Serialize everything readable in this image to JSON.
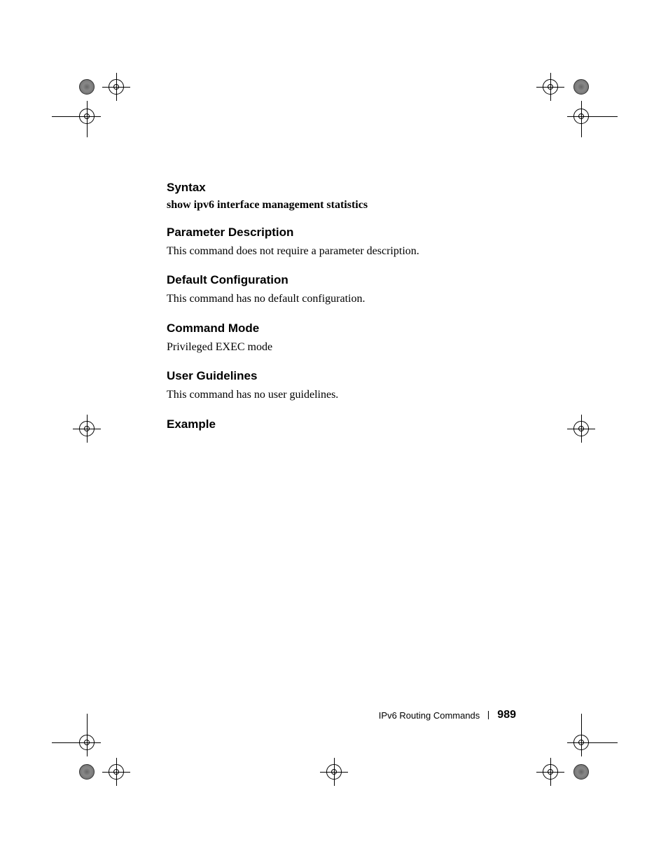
{
  "sections": {
    "syntax": {
      "heading": "Syntax",
      "text": "show ipv6 interface management statistics"
    },
    "parameter_description": {
      "heading": "Parameter Description",
      "text": "This command does not require a parameter description."
    },
    "default_configuration": {
      "heading": "Default Configuration",
      "text": "This command has no default configuration."
    },
    "command_mode": {
      "heading": "Command Mode",
      "text": "Privileged EXEC mode"
    },
    "user_guidelines": {
      "heading": "User Guidelines",
      "text": "This command has no user guidelines."
    },
    "example": {
      "heading": "Example"
    }
  },
  "footer": {
    "section_title": "IPv6 Routing Commands",
    "page_number": "989"
  }
}
